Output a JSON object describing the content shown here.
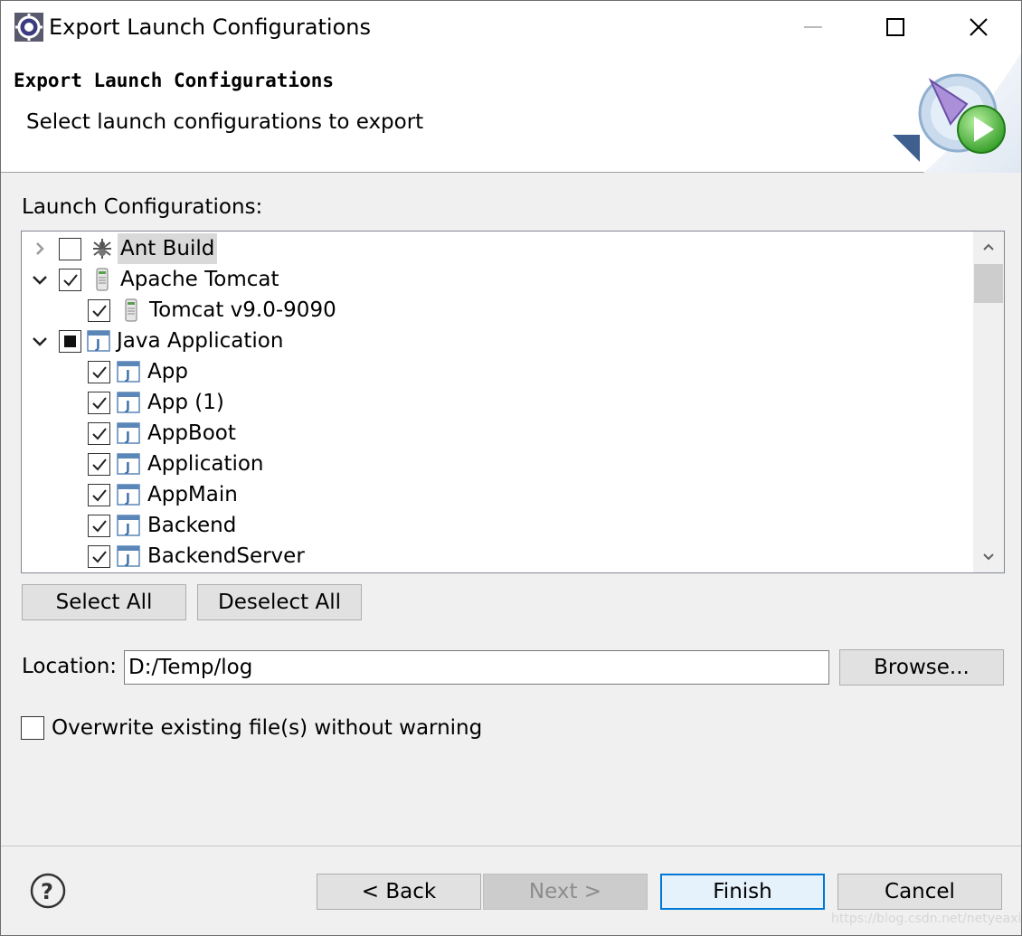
{
  "window": {
    "title": "Export Launch Configurations",
    "app_icon": "eclipse-gear-icon"
  },
  "banner": {
    "title": "Export Launch Configurations",
    "description": "Select launch configurations to export",
    "icon": "export-launch-wizard-icon"
  },
  "tree": {
    "label": "Launch Configurations:",
    "items": [
      {
        "label": "Ant Build",
        "icon": "ant-icon",
        "level": 0,
        "expanded": false,
        "state": "unchecked",
        "selected": true
      },
      {
        "label": "Apache Tomcat",
        "icon": "server-icon",
        "level": 0,
        "expanded": true,
        "state": "checked"
      },
      {
        "label": "Tomcat v9.0-9090",
        "icon": "server-icon",
        "level": 1,
        "state": "checked"
      },
      {
        "label": "Java Application",
        "icon": "java-app-icon",
        "level": 0,
        "expanded": true,
        "state": "partial"
      },
      {
        "label": "App",
        "icon": "java-app-icon",
        "level": 1,
        "state": "checked"
      },
      {
        "label": "App (1)",
        "icon": "java-app-icon",
        "level": 1,
        "state": "checked"
      },
      {
        "label": "AppBoot",
        "icon": "java-app-icon",
        "level": 1,
        "state": "checked"
      },
      {
        "label": "Application",
        "icon": "java-app-icon",
        "level": 1,
        "state": "checked"
      },
      {
        "label": "AppMain",
        "icon": "java-app-icon",
        "level": 1,
        "state": "checked"
      },
      {
        "label": "Backend",
        "icon": "java-app-icon",
        "level": 1,
        "state": "checked"
      },
      {
        "label": "BackendServer",
        "icon": "java-app-icon",
        "level": 1,
        "state": "checked"
      }
    ]
  },
  "buttons": {
    "select_all": "Select All",
    "deselect_all": "Deselect All",
    "browse": "Browse...",
    "back": "< Back",
    "next": "Next >",
    "finish": "Finish",
    "cancel": "Cancel"
  },
  "location": {
    "label": "Location:",
    "value": "D:/Temp/log"
  },
  "overwrite": {
    "label": "Overwrite existing file(s) without warning",
    "checked": false
  },
  "watermark": "https://blog.csdn.net/netyeaxi",
  "colors": {
    "accent": "#0078d7",
    "selection": "#d9d9d9",
    "dialog_bg": "#f0f0f0"
  }
}
